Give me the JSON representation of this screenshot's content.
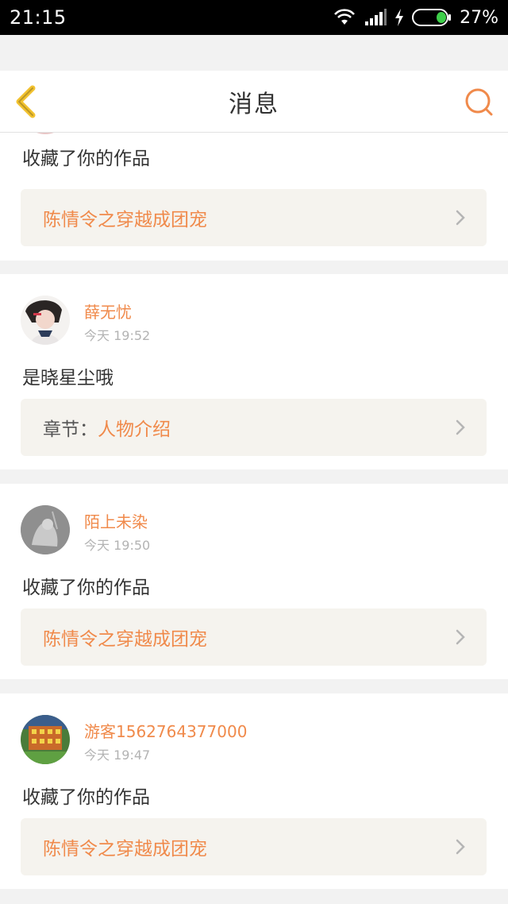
{
  "status_bar": {
    "time": "21:15",
    "battery_percent": "27%",
    "icons": [
      "wifi-icon",
      "signal-icon",
      "charging-icon",
      "battery-icon"
    ]
  },
  "header": {
    "title": "消息",
    "back_icon": "chevron-left-icon",
    "search_icon": "search-icon"
  },
  "colors": {
    "accent": "#f08a4b",
    "back_icon": "#f2c230",
    "background": "#f2f2f2",
    "ref_box": "#f5f3ee"
  },
  "messages": [
    {
      "text": "收藏了你的作品",
      "ref": {
        "label": "",
        "value": "陈情令之穿越成团宠"
      }
    },
    {
      "user": "薛无忧",
      "time": "今天 19:52",
      "text": "是晓星尘哦",
      "ref": {
        "label": "章节：",
        "value": "人物介绍"
      }
    },
    {
      "user": "陌上未染",
      "time": "今天 19:50",
      "text": "收藏了你的作品",
      "ref": {
        "label": "",
        "value": "陈情令之穿越成团宠"
      }
    },
    {
      "user": "游客1562764377000",
      "time": "今天 19:47",
      "text": "收藏了你的作品",
      "ref": {
        "label": "",
        "value": "陈情令之穿越成团宠"
      }
    }
  ]
}
